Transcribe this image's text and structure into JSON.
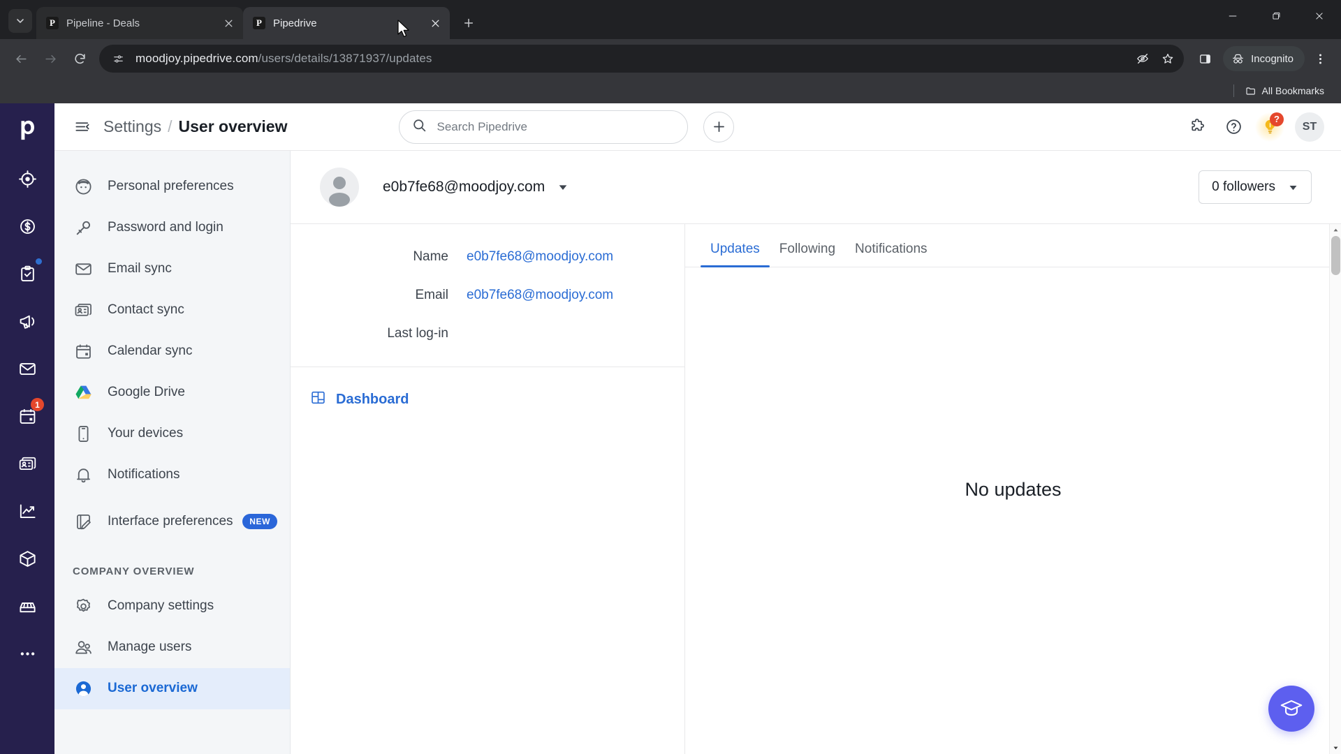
{
  "browser": {
    "tabs": [
      {
        "title": "Pipeline - Deals",
        "favicon": "pipedrive-favicon",
        "active": false
      },
      {
        "title": "Pipedrive",
        "favicon": "pipedrive-favicon",
        "active": true
      }
    ],
    "new_tab_label": "+",
    "window_controls": {
      "minimize": "minimize-icon",
      "maximize": "maximize-icon",
      "close": "close-icon"
    },
    "nav": {
      "back": "back-icon",
      "forward": "forward-icon",
      "reload": "reload-icon"
    },
    "omnibox": {
      "site_settings_icon": "site-settings-icon",
      "url_host": "moodjoy.pipedrive.com",
      "url_path": "/users/details/13871937/updates",
      "tracking_protection_icon": "eye-off-icon",
      "bookmark_icon": "star-icon"
    },
    "side_panel_icon": "side-panel-icon",
    "incognito_label": "Incognito",
    "menu_icon": "three-dot-menu-icon",
    "bookmarks_bar": {
      "all_bookmarks_label": "All Bookmarks",
      "folder_icon": "folder-icon"
    }
  },
  "rail": {
    "logo": "pipedrive-logo",
    "items": [
      {
        "name": "leads",
        "icon": "target-icon",
        "badge": null,
        "dot": false
      },
      {
        "name": "deals",
        "icon": "dollar-coin-icon",
        "badge": null,
        "dot": false
      },
      {
        "name": "activities",
        "icon": "clipboard-check-icon",
        "badge": null,
        "dot": true
      },
      {
        "name": "campaigns",
        "icon": "megaphone-icon",
        "badge": null,
        "dot": false
      },
      {
        "name": "mail",
        "icon": "envelope-icon",
        "badge": null,
        "dot": false
      },
      {
        "name": "calendar",
        "icon": "calendar-icon",
        "badge": "1",
        "dot": false
      },
      {
        "name": "contacts",
        "icon": "contact-cards-icon",
        "badge": null,
        "dot": false
      },
      {
        "name": "insights",
        "icon": "line-chart-icon",
        "badge": null,
        "dot": false
      },
      {
        "name": "products",
        "icon": "box-icon",
        "badge": null,
        "dot": false
      },
      {
        "name": "marketplace",
        "icon": "storefront-icon",
        "badge": null,
        "dot": false
      }
    ],
    "more_label": "•••"
  },
  "header": {
    "menu_toggle_icon": "collapse-menu-icon",
    "breadcrumb_root": "Settings",
    "breadcrumb_separator": "/",
    "breadcrumb_current": "User overview",
    "search": {
      "placeholder": "Search Pipedrive",
      "value": "",
      "icon": "search-icon"
    },
    "add_button_icon": "plus-icon",
    "apps_icon": "puzzle-piece-icon",
    "help_icon": "question-circle-icon",
    "tips_icon": "lightbulb-icon",
    "tips_badge": "?",
    "avatar_initials": "ST"
  },
  "settings_nav": {
    "items": [
      {
        "label": "Personal preferences",
        "icon": "person-face-icon",
        "active": false,
        "badge": null
      },
      {
        "label": "Password and login",
        "icon": "key-icon",
        "active": false,
        "badge": null
      },
      {
        "label": "Email sync",
        "icon": "envelope-icon",
        "active": false,
        "badge": null
      },
      {
        "label": "Contact sync",
        "icon": "contact-card-icon",
        "active": false,
        "badge": null
      },
      {
        "label": "Calendar sync",
        "icon": "calendar-icon",
        "active": false,
        "badge": null
      },
      {
        "label": "Google Drive",
        "icon": "google-drive-icon",
        "active": false,
        "badge": null
      },
      {
        "label": "Your devices",
        "icon": "phone-icon",
        "active": false,
        "badge": null
      },
      {
        "label": "Notifications",
        "icon": "bell-icon",
        "active": false,
        "badge": null
      },
      {
        "label": "Interface preferences",
        "icon": "interface-edit-icon",
        "active": false,
        "badge": "NEW"
      }
    ],
    "section_label": "COMPANY OVERVIEW",
    "section_items": [
      {
        "label": "Company settings",
        "icon": "gear-icon",
        "active": false,
        "badge": null
      },
      {
        "label": "Manage users",
        "icon": "users-icon",
        "active": false,
        "badge": null
      },
      {
        "label": "User overview",
        "icon": "user-circle-icon",
        "active": true,
        "badge": null
      }
    ]
  },
  "user": {
    "avatar_icon": "default-avatar-icon",
    "email": "e0b7fe68@moodjoy.com",
    "caret_icon": "chevron-down-icon",
    "followers_label": "0 followers",
    "followers_caret": "chevron-down-icon",
    "fields": [
      {
        "label": "Name",
        "value": "e0b7fe68@moodjoy.com",
        "link": true
      },
      {
        "label": "Email",
        "value": "e0b7fe68@moodjoy.com",
        "link": true
      },
      {
        "label": "Last log-in",
        "value": "",
        "link": false
      }
    ],
    "dashboard_label": "Dashboard",
    "dashboard_icon": "dashboard-grid-icon"
  },
  "activity": {
    "tabs": [
      {
        "label": "Updates",
        "active": true
      },
      {
        "label": "Following",
        "active": false
      },
      {
        "label": "Notifications",
        "active": false
      }
    ],
    "empty_message": "No updates"
  },
  "fab": {
    "icon": "graduation-cap-icon",
    "color": "#5d5fef"
  },
  "colors": {
    "brand_purple": "#26204d",
    "link_blue": "#2a6cd4",
    "active_nav_bg": "#e4edfb",
    "badge_red": "#e5472c",
    "new_badge_blue": "#2a66d9"
  }
}
